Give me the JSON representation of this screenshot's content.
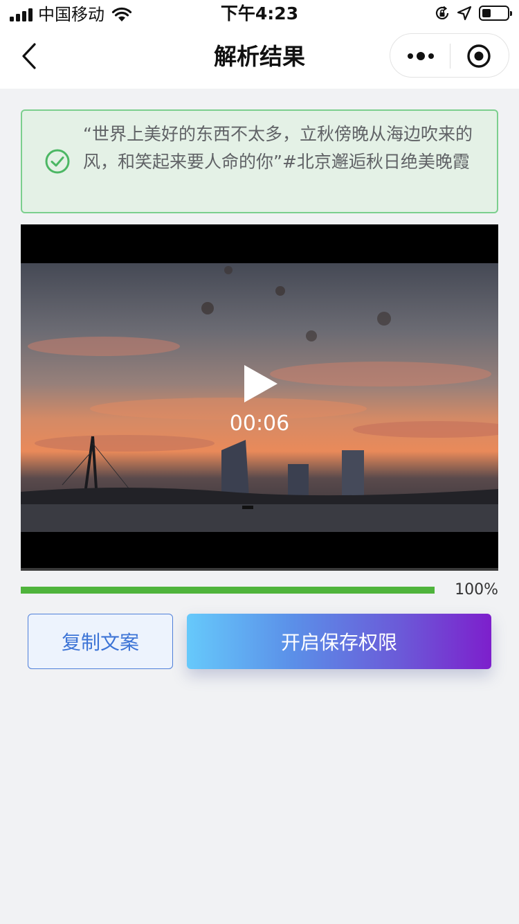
{
  "status_bar": {
    "carrier": "中国移动",
    "time": "下午4:23"
  },
  "nav": {
    "title": "解析结果"
  },
  "result": {
    "text": "“世界上美好的东西不太多，立秋傍晚从海边吹来的风，和笑起来要人命的你”#北京邂逅秋日绝美晚霞"
  },
  "video": {
    "duration": "00:06"
  },
  "progress": {
    "label": "100%",
    "value": 1.0
  },
  "actions": {
    "copy_label": "复制文案",
    "save_label": "开启保存权限"
  },
  "colors": {
    "success_green": "#4fb43c",
    "copy_blue": "#3d74d6",
    "gradient_start": "#66c9fb",
    "gradient_end": "#7d1fcc"
  }
}
